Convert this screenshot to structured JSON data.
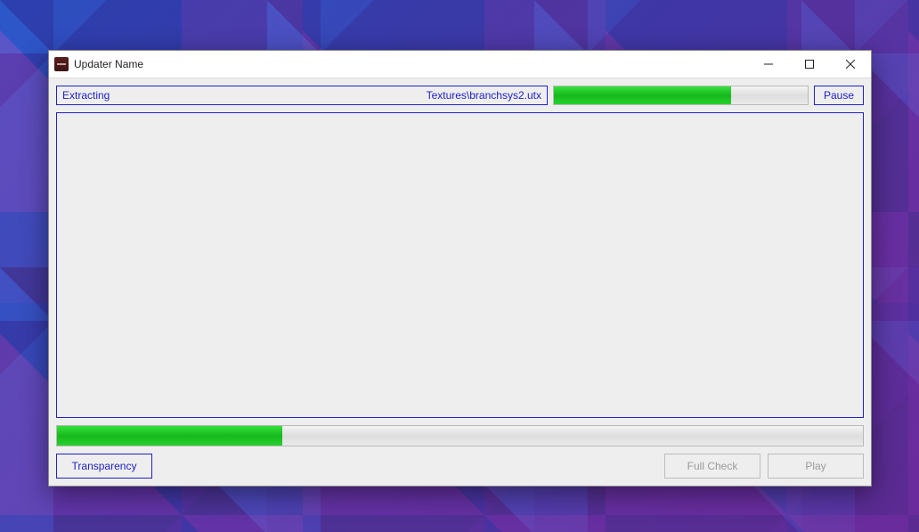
{
  "window": {
    "title": "Updater Name"
  },
  "top": {
    "status_label": "Extracting",
    "current_file": "Textures\\branchsys2.utx",
    "file_progress_pct": 70,
    "pause_label": "Pause"
  },
  "overall_progress_pct": 28,
  "bottom": {
    "transparency_label": "Transparency",
    "full_check_label": "Full Check",
    "play_label": "Play"
  }
}
